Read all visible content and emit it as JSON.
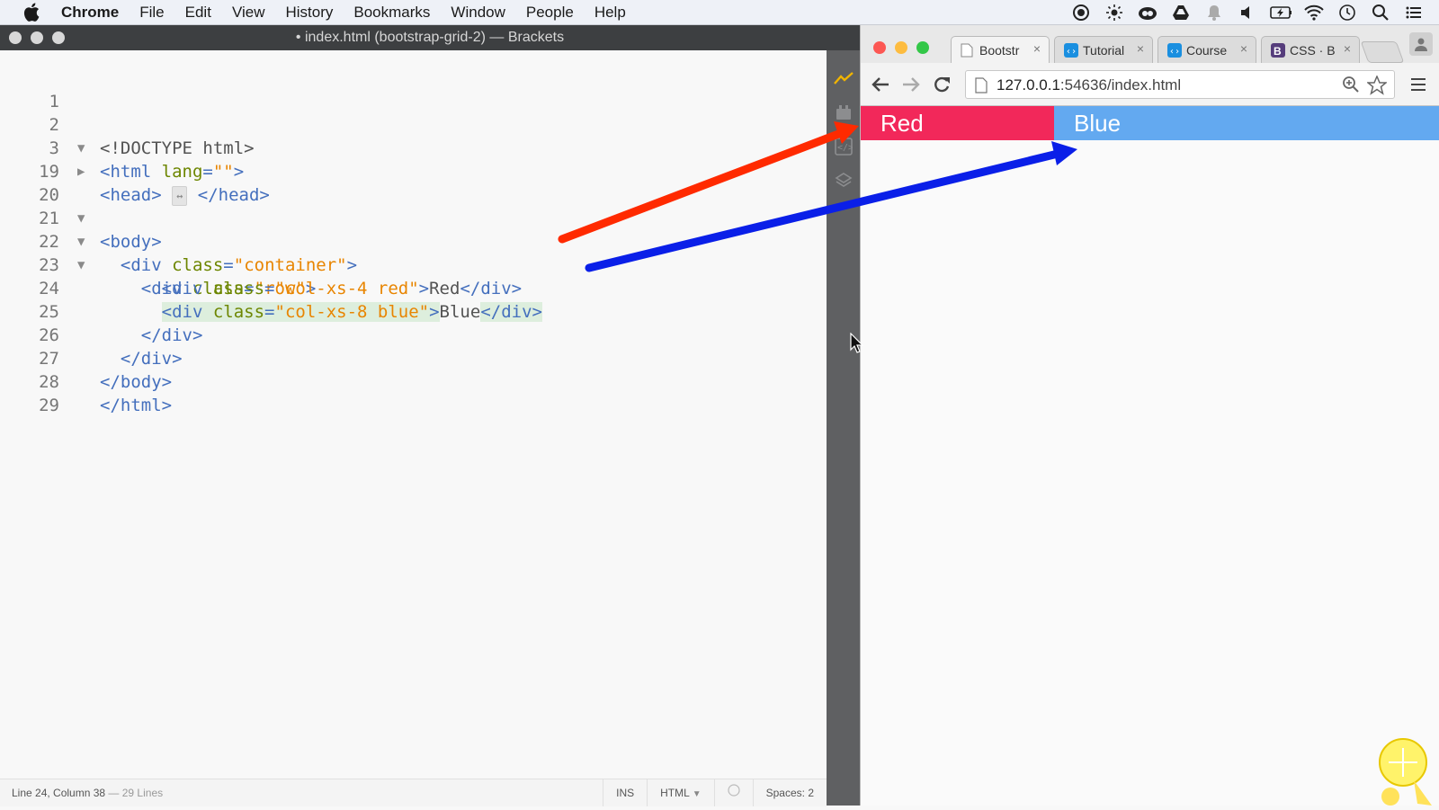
{
  "menubar": {
    "app_name": "Chrome",
    "items": [
      "File",
      "Edit",
      "View",
      "History",
      "Bookmarks",
      "Window",
      "People",
      "Help"
    ],
    "tray_icons": [
      "record-icon",
      "brightness-icon",
      "creative-cloud-icon",
      "drive-icon",
      "notification-bell-icon",
      "volume-icon",
      "battery-icon",
      "wifi-icon",
      "clock-icon",
      "spotlight-search-icon",
      "list-icon"
    ]
  },
  "brackets": {
    "title": "• index.html (bootstrap-grid-2) — Brackets",
    "lines": [
      {
        "num": "1",
        "fold": ""
      },
      {
        "num": "2",
        "fold": "▼"
      },
      {
        "num": "3",
        "fold": "▶"
      },
      {
        "num": "19",
        "fold": ""
      },
      {
        "num": "20",
        "fold": "▼"
      },
      {
        "num": "21",
        "fold": "▼"
      },
      {
        "num": "22",
        "fold": "▼"
      },
      {
        "num": "23",
        "fold": ""
      },
      {
        "num": "24",
        "fold": ""
      },
      {
        "num": "25",
        "fold": ""
      },
      {
        "num": "26",
        "fold": ""
      },
      {
        "num": "27",
        "fold": ""
      },
      {
        "num": "28",
        "fold": ""
      },
      {
        "num": "29",
        "fold": ""
      }
    ],
    "code": {
      "l1": "<!DOCTYPE html>",
      "l2_open": "<html ",
      "l2_attr": "lang",
      "l2_eq": "=",
      "l2_str": "\"\"",
      "l2_close": ">",
      "l3_open": "<head>",
      "l3_collapsed": "↔",
      "l3_close": "</head>",
      "l20": "<body>",
      "l21_open": "<div ",
      "l21_attr": "class",
      "l21_eq": "=",
      "l21_str": "\"container\"",
      "l21_close": ">",
      "l22_open": "<div ",
      "l22_attr": "class",
      "l22_eq": "=",
      "l22_str": "\"row\"",
      "l22_close": ">",
      "l23_open": "<div ",
      "l23_attr": "class",
      "l23_eq": "=",
      "l23_str": "\"col-xs-4 red\"",
      "l23_gt": ">",
      "l23_text": "Red",
      "l23_end": "</div>",
      "l24_open": "<div ",
      "l24_attr": "class",
      "l24_eq": "=",
      "l24_str": "\"col-xs-8 blue\"",
      "l24_gt": ">",
      "l24_text": "Blue",
      "l24_end": "</div>",
      "l25": "</div>",
      "l26": "</div>",
      "l27": "</body>",
      "l28": "</html>"
    },
    "statusbar": {
      "position": "Line 24, Column 38",
      "lines": " — 29 Lines",
      "mode": "INS",
      "language": "HTML",
      "spaces": "Spaces: 2"
    }
  },
  "chrome": {
    "tabs": [
      {
        "label": "Bootstr",
        "favicon": "page-icon",
        "favcolor": "#ffffff"
      },
      {
        "label": "Tutorial",
        "favicon": "code-icon",
        "favcolor": "#1a8fe0"
      },
      {
        "label": "Course",
        "favicon": "code-icon",
        "favcolor": "#1a8fe0"
      },
      {
        "label": "CSS · B",
        "favicon": "bootstrap-icon",
        "favcolor": "#563d7c"
      }
    ],
    "tab_close": "×",
    "url_host": "127.0.0.1",
    "url_path": ":54636/index.html",
    "page": {
      "red_label": "Red",
      "blue_label": "Blue",
      "red_color": "#f2285a",
      "blue_color": "#63a9f0",
      "red_cols": 4,
      "blue_cols": 8,
      "grid_cols": 12
    }
  },
  "annotations": {
    "red_arrow_color": "#ff2a00",
    "blue_arrow_color": "#0a1fe8"
  }
}
